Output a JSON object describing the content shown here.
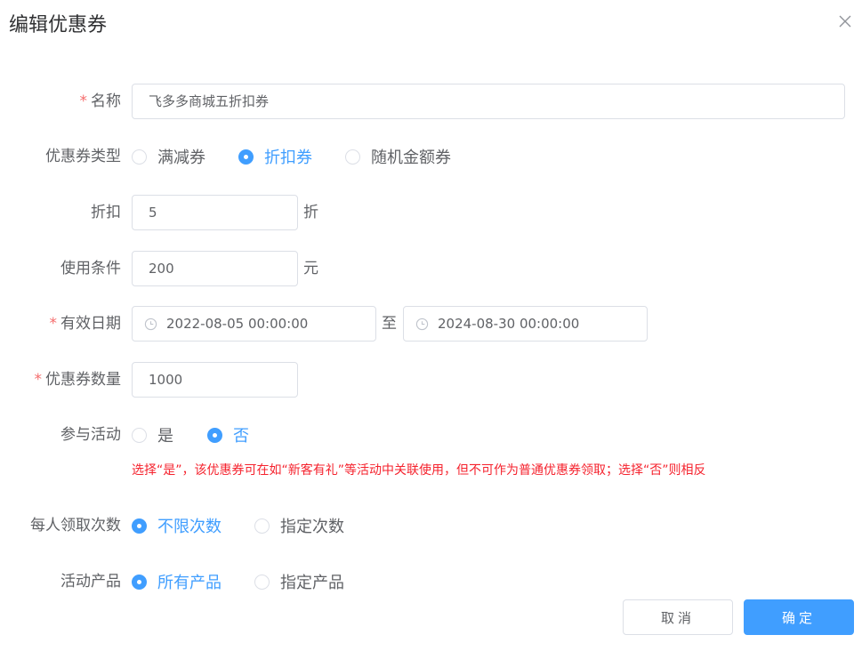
{
  "dialog": {
    "title": "编辑优惠券"
  },
  "form": {
    "name": {
      "label": "名称",
      "required": "*",
      "value": "飞多多商城五折扣券"
    },
    "coupon_type": {
      "label": "优惠券类型",
      "options": [
        "满减券",
        "折扣券",
        "随机金额券"
      ],
      "selected": "折扣券"
    },
    "discount": {
      "label": "折扣",
      "value": "5",
      "unit": "折"
    },
    "condition": {
      "label": "使用条件",
      "value": "200",
      "unit": "元"
    },
    "valid_date": {
      "label": "有效日期",
      "required": "*",
      "start": "2022-08-05 00:00:00",
      "separator": "至",
      "end": "2024-08-30 00:00:00"
    },
    "quantity": {
      "label": "优惠券数量",
      "required": "*",
      "value": "1000"
    },
    "activity": {
      "label": "参与活动",
      "options": [
        "是",
        "否"
      ],
      "selected": "否",
      "hint": "选择“是”，该优惠券可在如“新客有礼”等活动中关联使用，但不可作为普通优惠券领取；选择“否”则相反"
    },
    "claim_limit": {
      "label": "每人领取次数",
      "options": [
        "不限次数",
        "指定次数"
      ],
      "selected": "不限次数"
    },
    "products": {
      "label": "活动产品",
      "options": [
        "所有产品",
        "指定产品"
      ],
      "selected": "所有产品"
    }
  },
  "footer": {
    "cancel_label": "取消",
    "confirm_label": "确定"
  },
  "colors": {
    "primary": "#409eff",
    "required": "#f56c6c",
    "hint": "#f5222d",
    "border": "#dcdfe6"
  }
}
